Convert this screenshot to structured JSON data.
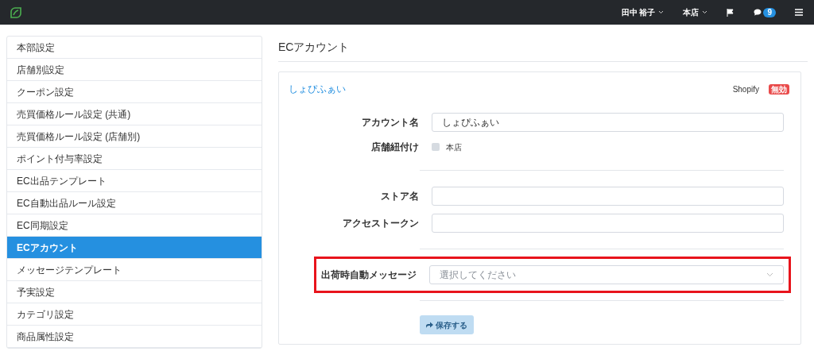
{
  "header": {
    "user": "田中 裕子",
    "store": "本店",
    "messages_count": "9"
  },
  "sidebar": {
    "items": [
      {
        "label": "本部設定",
        "selected": false
      },
      {
        "label": "店舗別設定",
        "selected": false
      },
      {
        "label": "クーポン設定",
        "selected": false
      },
      {
        "label": "売買価格ルール設定 (共通)",
        "selected": false
      },
      {
        "label": "売買価格ルール設定 (店舗別)",
        "selected": false
      },
      {
        "label": "ポイント付与率設定",
        "selected": false
      },
      {
        "label": "EC出品テンプレート",
        "selected": false
      },
      {
        "label": "EC自動出品ルール設定",
        "selected": false
      },
      {
        "label": "EC同期設定",
        "selected": false
      },
      {
        "label": "ECアカウント",
        "selected": true
      },
      {
        "label": "メッセージテンプレート",
        "selected": false
      },
      {
        "label": "予実設定",
        "selected": false
      },
      {
        "label": "カテゴリ設定",
        "selected": false
      },
      {
        "label": "商品属性設定",
        "selected": false
      }
    ]
  },
  "page_title": "ECアカウント",
  "card": {
    "title": "しょぴふぁい",
    "platform": "Shopify",
    "status_badge": "無効",
    "groups": [
      [
        {
          "kind": "text",
          "label": "アカウント名",
          "value": "しょぴふぁい",
          "highlighted": false
        },
        {
          "kind": "checkbox",
          "label": "店舗紐付け",
          "option": "本店",
          "checked": false,
          "highlighted": false
        }
      ],
      [
        {
          "kind": "text",
          "label": "ストア名",
          "highlighted": false
        },
        {
          "kind": "text",
          "label": "アクセストークン",
          "highlighted": false
        }
      ],
      [
        {
          "kind": "select",
          "label": "出荷時自動メッセージ",
          "placeholder": "選択してください",
          "highlighted": true
        }
      ]
    ],
    "save_button": {
      "label": "保存する",
      "disabled": true
    }
  }
}
